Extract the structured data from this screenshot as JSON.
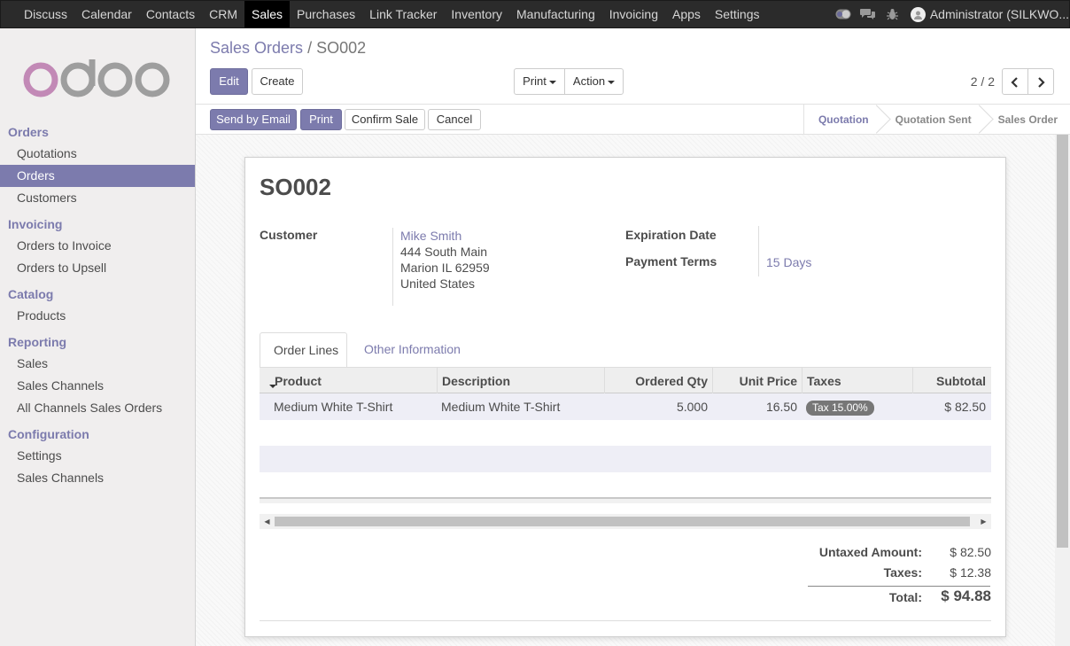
{
  "topbar": {
    "menu": [
      "Discuss",
      "Calendar",
      "Contacts",
      "CRM",
      "Sales",
      "Purchases",
      "Link Tracker",
      "Inventory",
      "Manufacturing",
      "Invoicing",
      "Apps",
      "Settings"
    ],
    "active": "Sales",
    "user": "Administrator (SILKWO..."
  },
  "sidebar": {
    "sections": [
      {
        "title": "Orders",
        "items": [
          "Quotations",
          "Orders",
          "Customers"
        ]
      },
      {
        "title": "Invoicing",
        "items": [
          "Orders to Invoice",
          "Orders to Upsell"
        ]
      },
      {
        "title": "Catalog",
        "items": [
          "Products"
        ]
      },
      {
        "title": "Reporting",
        "items": [
          "Sales",
          "Sales Channels",
          "All Channels Sales Orders"
        ]
      },
      {
        "title": "Configuration",
        "items": [
          "Settings",
          "Sales Channels"
        ]
      }
    ],
    "active_item": "Orders"
  },
  "breadcrumb": {
    "parent": "Sales Orders",
    "separator": "/",
    "current": "SO002"
  },
  "buttons": {
    "edit": "Edit",
    "create": "Create",
    "print": "Print",
    "action": "Action"
  },
  "pager": {
    "value": "2 / 2"
  },
  "statusbar": {
    "send_by_email": "Send by Email",
    "print": "Print",
    "confirm_sale": "Confirm Sale",
    "cancel": "Cancel",
    "stages": [
      "Quotation",
      "Quotation Sent",
      "Sales Order"
    ],
    "current_stage": "Quotation"
  },
  "form": {
    "name": "SO002",
    "customer_label": "Customer",
    "customer_name": "Mike Smith",
    "customer_address": [
      "444 South Main",
      "Marion IL 62959",
      "United States"
    ],
    "expiration_label": "Expiration Date",
    "expiration_value": "",
    "payment_terms_label": "Payment Terms",
    "payment_terms_value": "15 Days"
  },
  "tabs": [
    "Order Lines",
    "Other Information"
  ],
  "order_lines": {
    "columns": [
      "Product",
      "Description",
      "Ordered Qty",
      "Unit Price",
      "Taxes",
      "Subtotal"
    ],
    "rows": [
      {
        "product": "Medium White T-Shirt",
        "description": "Medium White T-Shirt",
        "qty": "5.000",
        "unit_price": "16.50",
        "taxes": "Tax 15.00%",
        "subtotal": "$ 82.50"
      }
    ]
  },
  "totals": {
    "untaxed_label": "Untaxed Amount:",
    "untaxed_value": "$ 82.50",
    "taxes_label": "Taxes:",
    "taxes_value": "$ 12.38",
    "total_label": "Total:",
    "total_value": "$ 94.88"
  },
  "colors": {
    "accent": "#7c7bad",
    "topbar": "#2b2b2b",
    "sidebar": "#f0eeee"
  }
}
